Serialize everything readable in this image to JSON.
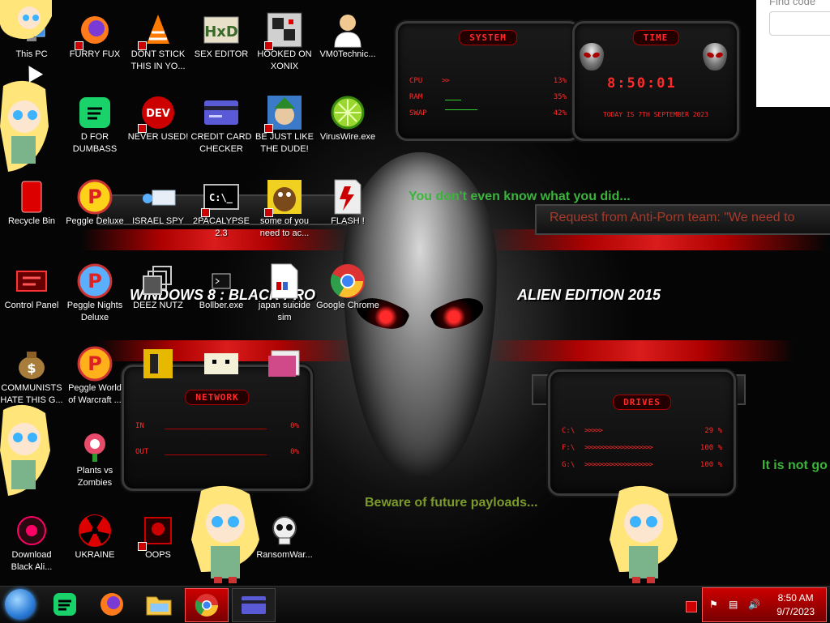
{
  "desktop": {
    "icons": [
      {
        "label": "This PC"
      },
      {
        "label": "FURRY FUX"
      },
      {
        "label": "DONT STICK THIS IN YO..."
      },
      {
        "label": "SEX EDITOR"
      },
      {
        "label": "HOOKED ON XONIX"
      },
      {
        "label": "VM0Technic..."
      },
      {
        "label": "D FOR DUMBASS"
      },
      {
        "label": "NEVER USED!"
      },
      {
        "label": "CREDIT CARD CHECKER"
      },
      {
        "label": "BE JUST LIKE THE DUDE!"
      },
      {
        "label": "VirusWire.exe"
      },
      {
        "label": "Recycle Bin"
      },
      {
        "label": "Peggle Deluxe"
      },
      {
        "label": "ISRAEL SPY"
      },
      {
        "label": "2PACALYPSE 2.3"
      },
      {
        "label": "some of you need to ac..."
      },
      {
        "label": "FLASH !"
      },
      {
        "label": "Control Panel"
      },
      {
        "label": "Peggle Nights Deluxe"
      },
      {
        "label": "DEEZ NUTZ"
      },
      {
        "label": "Bollber.exe"
      },
      {
        "label": "japan suicide sim"
      },
      {
        "label": "Google Chrome"
      },
      {
        "label": "COMMUNISTS HATE THIS G..."
      },
      {
        "label": "Peggle World of Warcraft ..."
      },
      {
        "label": "Plants vs Zombies"
      },
      {
        "label": "Download Black Ali..."
      },
      {
        "label": "UKRAINE"
      },
      {
        "label": "OOPS"
      },
      {
        "label": "RansomWar..."
      }
    ],
    "icon_glyphs": {
      "dev": "DEV",
      "cmd": "C:\\_",
      "p": "P",
      "money": "$"
    },
    "messages": {
      "know": "You don't even know what you did...",
      "request": "Request from Anti-Porn team: \"We need to",
      "beware": "Beware of future payloads...",
      "not_go": "It is not go"
    },
    "brand": {
      "windows": "WINDOWS 8 : BLACK PRO",
      "alien": "ALIEN EDITION 2015"
    },
    "find_box_text": "Find code"
  },
  "widgets": {
    "system": {
      "title": "SYSTEM",
      "rows": [
        {
          "label": "CPU",
          "value": "13%",
          "arrows": ">>"
        },
        {
          "label": "RAM",
          "value": "35%",
          "arrows": ""
        },
        {
          "label": "SWAP",
          "value": "42%",
          "arrows": ""
        }
      ]
    },
    "time": {
      "title": "TIME",
      "clock": "8:50:01",
      "date": "TODAY IS 7TH SEPTEMBER 2023"
    },
    "network": {
      "title": "NETWORK",
      "rows": [
        {
          "label": "IN",
          "value": "0%"
        },
        {
          "label": "OUT",
          "value": "0%"
        }
      ]
    },
    "drives": {
      "title": "DRIVES",
      "rows": [
        {
          "label": "C:\\",
          "value": "29 %",
          "arrows": ">>>>>"
        },
        {
          "label": "F:\\",
          "value": "100 %",
          "arrows": ">>>>>>>>>>>>>>>>>>>"
        },
        {
          "label": "G:\\",
          "value": "100 %",
          "arrows": ">>>>>>>>>>>>>>>>>>>"
        }
      ]
    }
  },
  "taskbar": {
    "apps": [
      "start",
      "spotify",
      "firefox",
      "file-explorer",
      "google-chrome",
      "credit-card-checker"
    ],
    "time": "8:50 AM",
    "date": "9/7/2023"
  },
  "colors": {
    "accent_red": "#ff2a2a",
    "green_text": "#3cb43c",
    "tray_red": "#c00000"
  }
}
